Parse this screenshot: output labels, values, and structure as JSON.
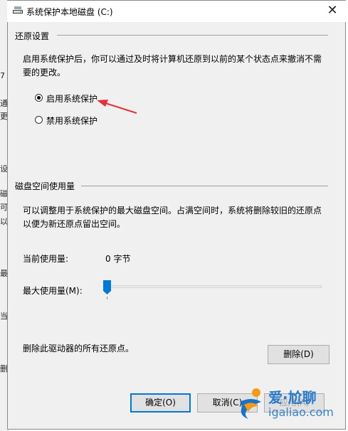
{
  "background_window": {
    "fragments": [
      "7",
      "通",
      "更",
      "设",
      "磁",
      "可",
      "以",
      "最",
      "当",
      "删"
    ]
  },
  "titlebar": {
    "title": "系统保护本地磁盘 (C:)",
    "icon": "drive-icon",
    "close_glyph": "✕"
  },
  "restore_settings": {
    "group_label": "还原设置",
    "description_line1": "启用系统保护后，你可以通过及时将计算机还原到以前的某个状态点来撤消不需",
    "description_line2": "要的更改。",
    "options": [
      {
        "label": "启用系统保护",
        "checked": true
      },
      {
        "label": "禁用系统保护",
        "checked": false
      }
    ]
  },
  "disk_usage": {
    "group_label": "磁盘空间使用量",
    "description_line1": "可以调整用于系统保护的最大磁盘空间。占满空间时，系统将删除较旧的还原点",
    "description_line2": "以便为新还原点留出空间。",
    "current_label": "当前使用量:",
    "current_value": "0 字节",
    "max_label": "最大使用量(M):",
    "slider_level": 0
  },
  "delete_section": {
    "text": "删除此驱动器的所有还原点。",
    "button": "删除(D)"
  },
  "footer": {
    "ok": "确定(O)",
    "cancel": "取消(C)",
    "apply": "应用(A)"
  },
  "watermark": {
    "line1": "爱·尬聊",
    "line2": "igaliao.com"
  },
  "colors": {
    "annotation_arrow": "#e8303a",
    "default_button_border": "#0078d7",
    "slider_thumb": "#0078d7",
    "watermark_orange": "#f39c12",
    "watermark_blue": "#1a73c8"
  }
}
